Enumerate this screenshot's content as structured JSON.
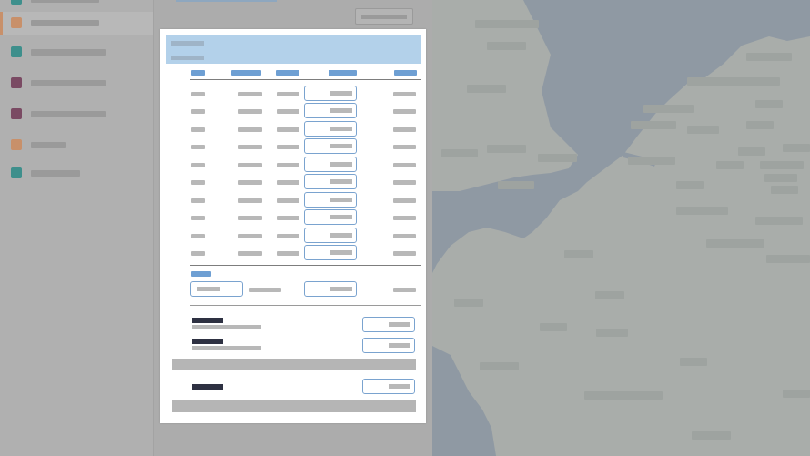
{
  "colors": {
    "water": "#8f99a3",
    "land": "#a9adaa",
    "accent": "#6e9fd3",
    "header_bg": "#b3d1ea",
    "swatch_orange": "#c8906a",
    "swatch_teal": "#3e8f8c",
    "swatch_plum": "#7a4a63"
  },
  "sidebar": {
    "items": [
      {
        "swatch": "#3e8f8c",
        "active": false
      },
      {
        "swatch": "#c8906a",
        "active": true
      },
      {
        "swatch": "#3e8f8c",
        "active": false
      },
      {
        "swatch": "#7a4a63",
        "active": false
      },
      {
        "swatch": "#7a4a63",
        "active": false
      },
      {
        "swatch": "#c8906a",
        "active": false
      },
      {
        "swatch": "#3e8f8c",
        "active": false
      }
    ]
  },
  "icons": {
    "map": "map-icon"
  }
}
